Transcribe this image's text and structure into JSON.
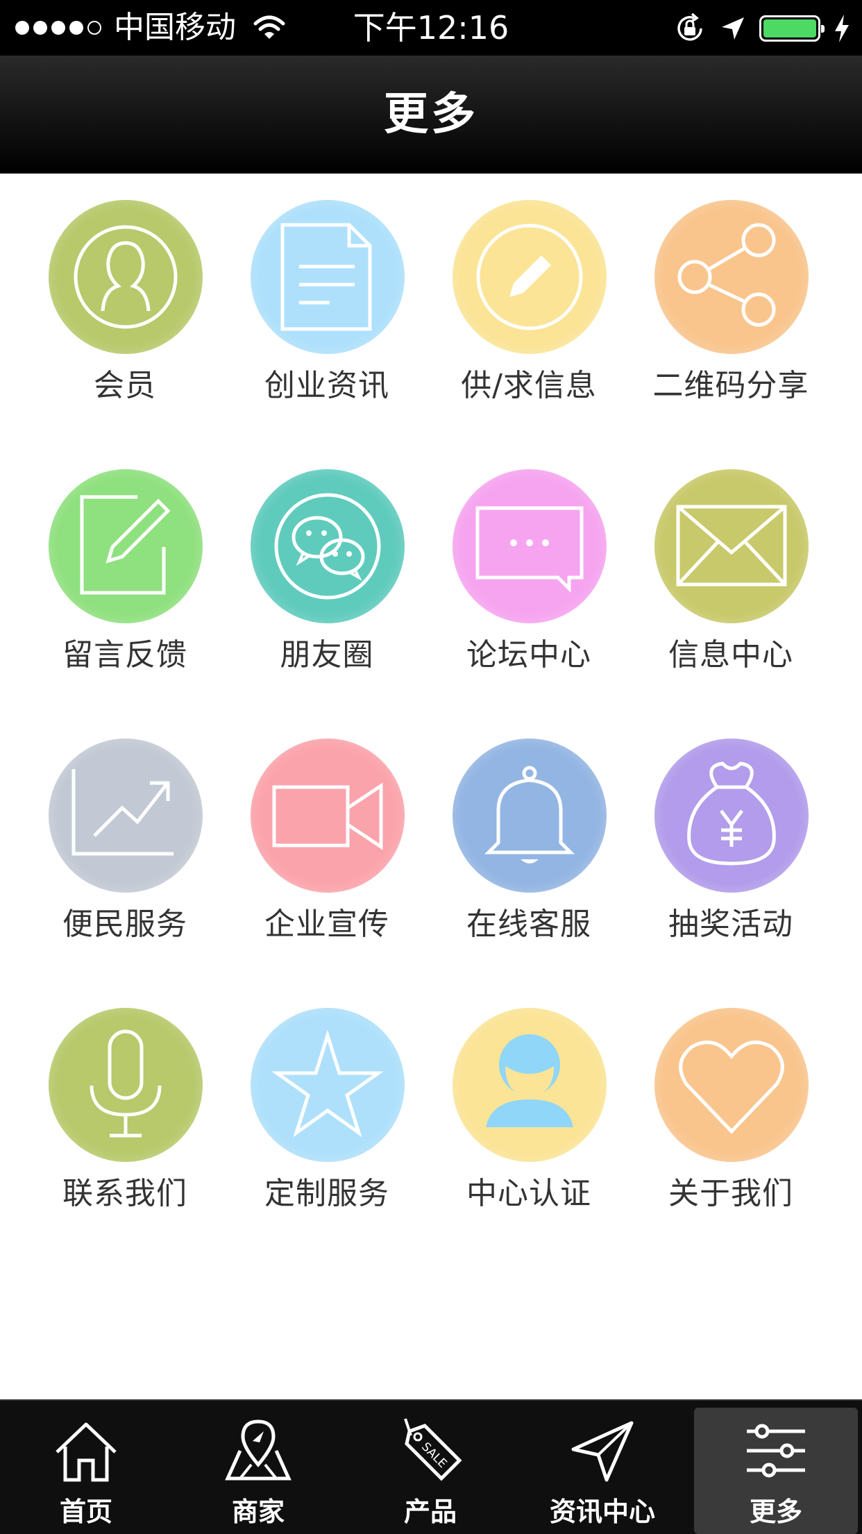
{
  "status_bar": {
    "carrier": "中国移动",
    "time": "下午12:16",
    "battery_color": "#4cd964"
  },
  "nav": {
    "title": "更多"
  },
  "grid": [
    {
      "label": "会员",
      "color": "#b7c96b",
      "icon": "user-icon"
    },
    {
      "label": "创业资讯",
      "color": "#aee0fb",
      "icon": "document-icon"
    },
    {
      "label": "供/求信息",
      "color": "#fbe496",
      "icon": "pencil-circle-icon"
    },
    {
      "label": "二维码分享",
      "color": "#f9c58d",
      "icon": "share-icon"
    },
    {
      "label": "留言反馈",
      "color": "#8fe07e",
      "icon": "edit-icon"
    },
    {
      "label": "朋友圈",
      "color": "#5fcbbd",
      "icon": "wechat-icon"
    },
    {
      "label": "论坛中心",
      "color": "#f6a4ef",
      "icon": "chat-bubble-icon"
    },
    {
      "label": "信息中心",
      "color": "#c8c96a",
      "icon": "envelope-icon"
    },
    {
      "label": "便民服务",
      "color": "#c3c9d4",
      "icon": "chart-trend-icon"
    },
    {
      "label": "企业宣传",
      "color": "#fba3ab",
      "icon": "video-camera-icon"
    },
    {
      "label": "在线客服",
      "color": "#93b5e3",
      "icon": "bell-icon"
    },
    {
      "label": "抽奖活动",
      "color": "#b29ceb",
      "icon": "money-bag-icon"
    },
    {
      "label": "联系我们",
      "color": "#b7c96b",
      "icon": "microphone-icon"
    },
    {
      "label": "定制服务",
      "color": "#aee0fb",
      "icon": "star-icon"
    },
    {
      "label": "中心认证",
      "color": "#fbe496",
      "icon": "person-icon"
    },
    {
      "label": "关于我们",
      "color": "#f9c58d",
      "icon": "heart-icon"
    }
  ],
  "tabs": [
    {
      "label": "首页",
      "icon": "home-icon",
      "active": false
    },
    {
      "label": "商家",
      "icon": "map-pin-icon",
      "active": false
    },
    {
      "label": "产品",
      "icon": "sale-tag-icon",
      "active": false,
      "tag_text": "SALE"
    },
    {
      "label": "资讯中心",
      "icon": "paper-plane-icon",
      "active": false
    },
    {
      "label": "更多",
      "icon": "sliders-icon",
      "active": true
    }
  ]
}
